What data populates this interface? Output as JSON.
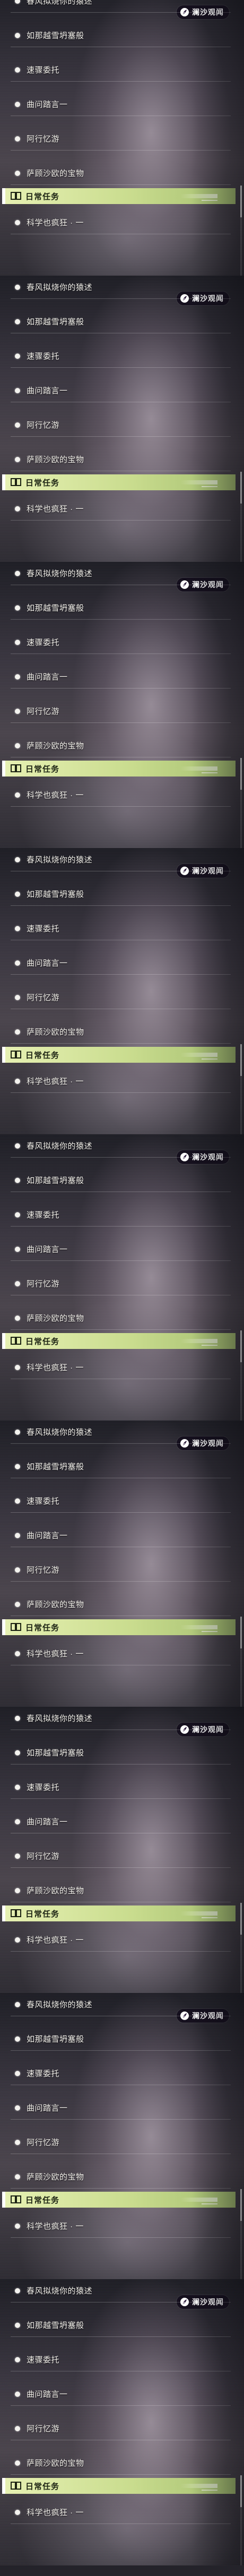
{
  "header": {
    "title": "日常任务",
    "book_icon": "book-icon"
  },
  "badge": {
    "text": "澜沙观闻",
    "icon": "feather-icon"
  },
  "quests": [
    {
      "label": "春风拟烧你的猿述"
    },
    {
      "label": "如那越雪坍塞般"
    },
    {
      "label": "速骤委托"
    },
    {
      "label": "曲问踏言一"
    },
    {
      "label": "阿行忆游"
    },
    {
      "label": "萨顾沙欧的宝物"
    }
  ],
  "daily_quest": {
    "label": "科学也疯狂 · 一"
  },
  "colors": {
    "header_green": "#c9dc8e",
    "marker_red": "#e04650",
    "badge_bg": "#140e1c"
  }
}
